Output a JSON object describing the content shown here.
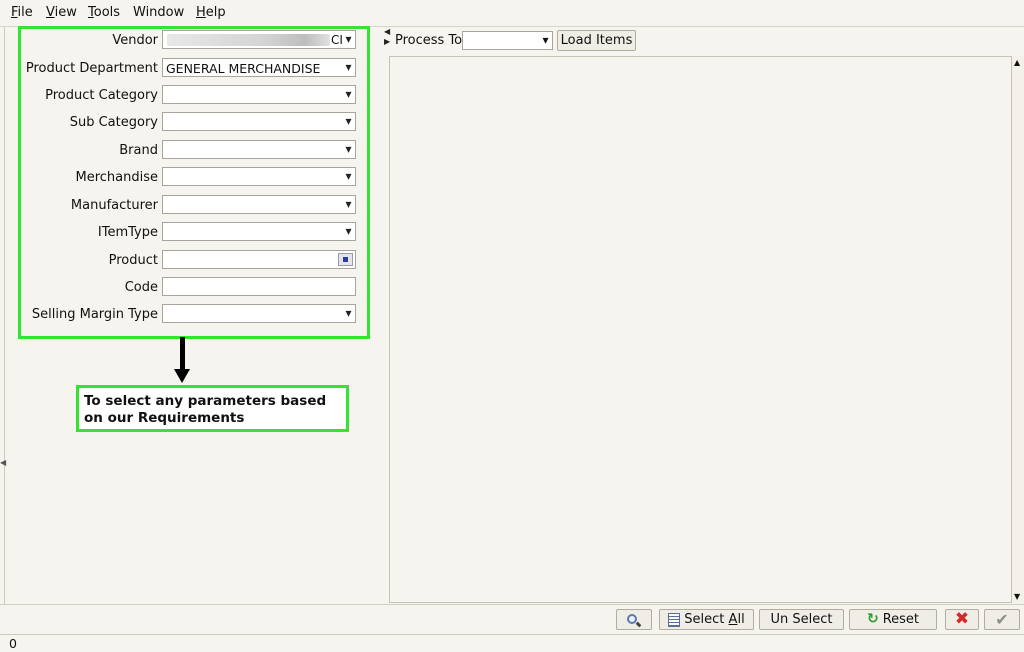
{
  "menu": {
    "file": {
      "u": "F",
      "rest": "ile"
    },
    "view": {
      "u": "V",
      "rest": "iew"
    },
    "tools": {
      "u": "T",
      "rest": "ools"
    },
    "window": {
      "label": "Window"
    },
    "help": {
      "u": "H",
      "rest": "elp"
    }
  },
  "filters": {
    "vendor": {
      "label": "Vendor",
      "value_tail": "CI"
    },
    "product_department": {
      "label": "Product Department",
      "value": "GENERAL MERCHANDISE"
    },
    "product_category": {
      "label": "Product Category",
      "value": ""
    },
    "sub_category": {
      "label": "Sub Category",
      "value": ""
    },
    "brand": {
      "label": "Brand",
      "value": ""
    },
    "merchandise": {
      "label": "Merchandise",
      "value": ""
    },
    "manufacturer": {
      "label": "Manufacturer",
      "value": ""
    },
    "item_type": {
      "label": "ITemType",
      "value": ""
    },
    "product": {
      "label": "Product",
      "value": ""
    },
    "code": {
      "label": "Code",
      "value": ""
    },
    "selling_margin_type": {
      "label": "Selling Margin Type",
      "value": ""
    }
  },
  "annotation": {
    "text": "To select any parameters based on our Requirements",
    "color": "#35e333"
  },
  "right": {
    "process_to_label": "Process To",
    "process_to_value": "",
    "load_items_label": "Load Items"
  },
  "toolbar": {
    "select_all": {
      "u": "Select ",
      "accel": "A",
      "rest": "ll"
    },
    "un_select": "Un Select",
    "reset": "Reset",
    "search_icon": "search-icon",
    "cancel_icon": "close-icon",
    "ok_icon": "check-icon"
  },
  "status": {
    "text": "0"
  }
}
